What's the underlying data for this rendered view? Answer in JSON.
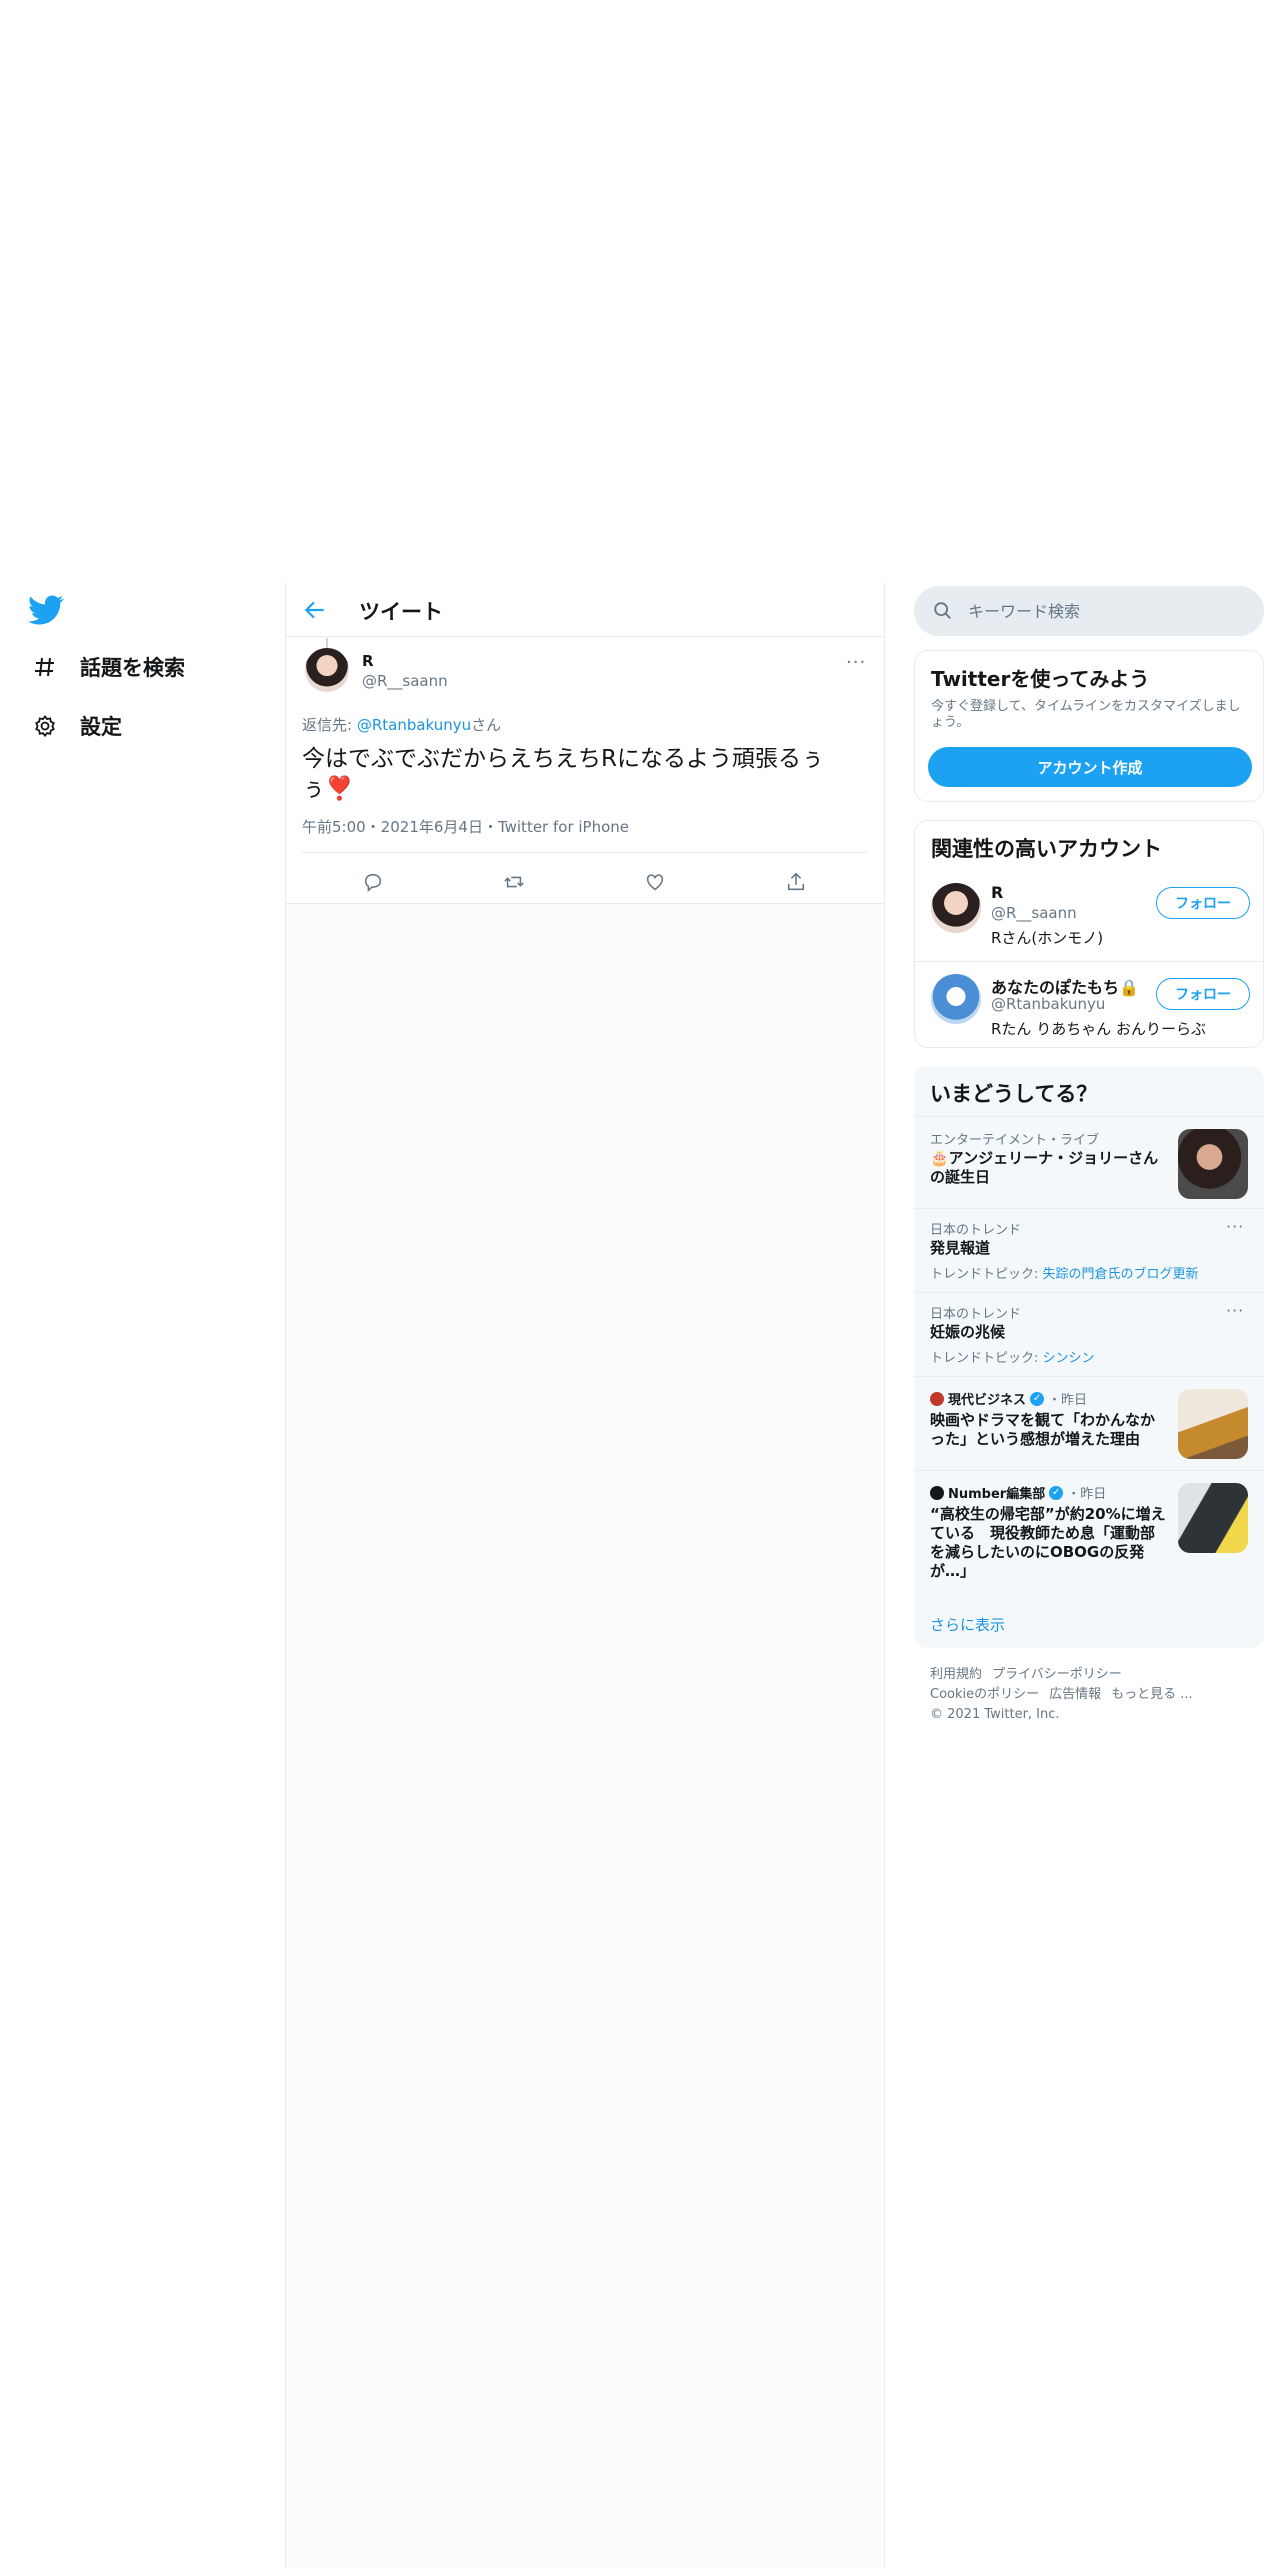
{
  "nav": {
    "logo_icon": "twitter-bird-icon",
    "items": [
      {
        "label": "話題を検索",
        "icon": "hashtag-icon"
      },
      {
        "label": "設定",
        "icon": "gear-icon"
      }
    ]
  },
  "center": {
    "title": "ツイート",
    "tweet": {
      "name": "R",
      "handle": "@R__saann",
      "reply_prefix": "返信先: ",
      "reply_handle": "@Rtanbakunyu",
      "reply_suffix": "さん",
      "text": "今はでぶでぶだからえちえちRになるよう頑張るぅぅ❣️",
      "meta": "午前5:00・2021年6月4日・Twitter for iPhone",
      "more": "···"
    }
  },
  "search": {
    "placeholder": "キーワード検索"
  },
  "signup": {
    "title": "Twitterを使ってみよう",
    "description": "今すぐ登録して、タイムラインをカスタマイズしましょう。",
    "button": "アカウント作成"
  },
  "related": {
    "title": "関連性の高いアカウント",
    "accounts": [
      {
        "name": "R",
        "handle": "@R__saann",
        "bio": "Rさん(ホンモノ)",
        "follow": "フォロー"
      },
      {
        "name": "あなたのぽたもち🔒",
        "handle": "@Rtanbakunyu",
        "bio": "Rたん りあちゃん おんりーらぶ",
        "follow": "フォロー"
      }
    ]
  },
  "trends": {
    "title": "いまどうしてる？",
    "items": [
      {
        "category": "エンターテイメント・ライブ",
        "title": "🎂アンジェリーナ・ジョリーさんの誕生日"
      },
      {
        "category": "日本のトレンド",
        "title": "発見報道",
        "topic_prefix": "トレンドトピック: ",
        "topic": "失踪の門倉氏のブログ更新"
      },
      {
        "category": "日本のトレンド",
        "title": "妊娠の兆候",
        "topic_prefix": "トレンドトピック: ",
        "topic": "シンシン"
      },
      {
        "source": "現代ビジネス",
        "time": "・昨日",
        "title": "映画やドラマを観て「わかんなかった」という感想が増えた理由"
      },
      {
        "source": "Number編集部",
        "time": "・昨日",
        "title": "“高校生の帰宅部”が約20%に増えている　現役教師ため息「運動部を減らしたいのにOBOGの反発が…」"
      }
    ],
    "show_more": "さらに表示"
  },
  "footer": {
    "links": [
      "利用規約",
      "プライバシーポリシー",
      "Cookieのポリシー",
      "広告情報",
      "もっと見る ..."
    ],
    "copyright": "© 2021 Twitter, Inc."
  },
  "colors": {
    "accent": "#1da1f2",
    "link": "#1b95e0",
    "muted": "#657786",
    "border": "#e6ecf0"
  }
}
